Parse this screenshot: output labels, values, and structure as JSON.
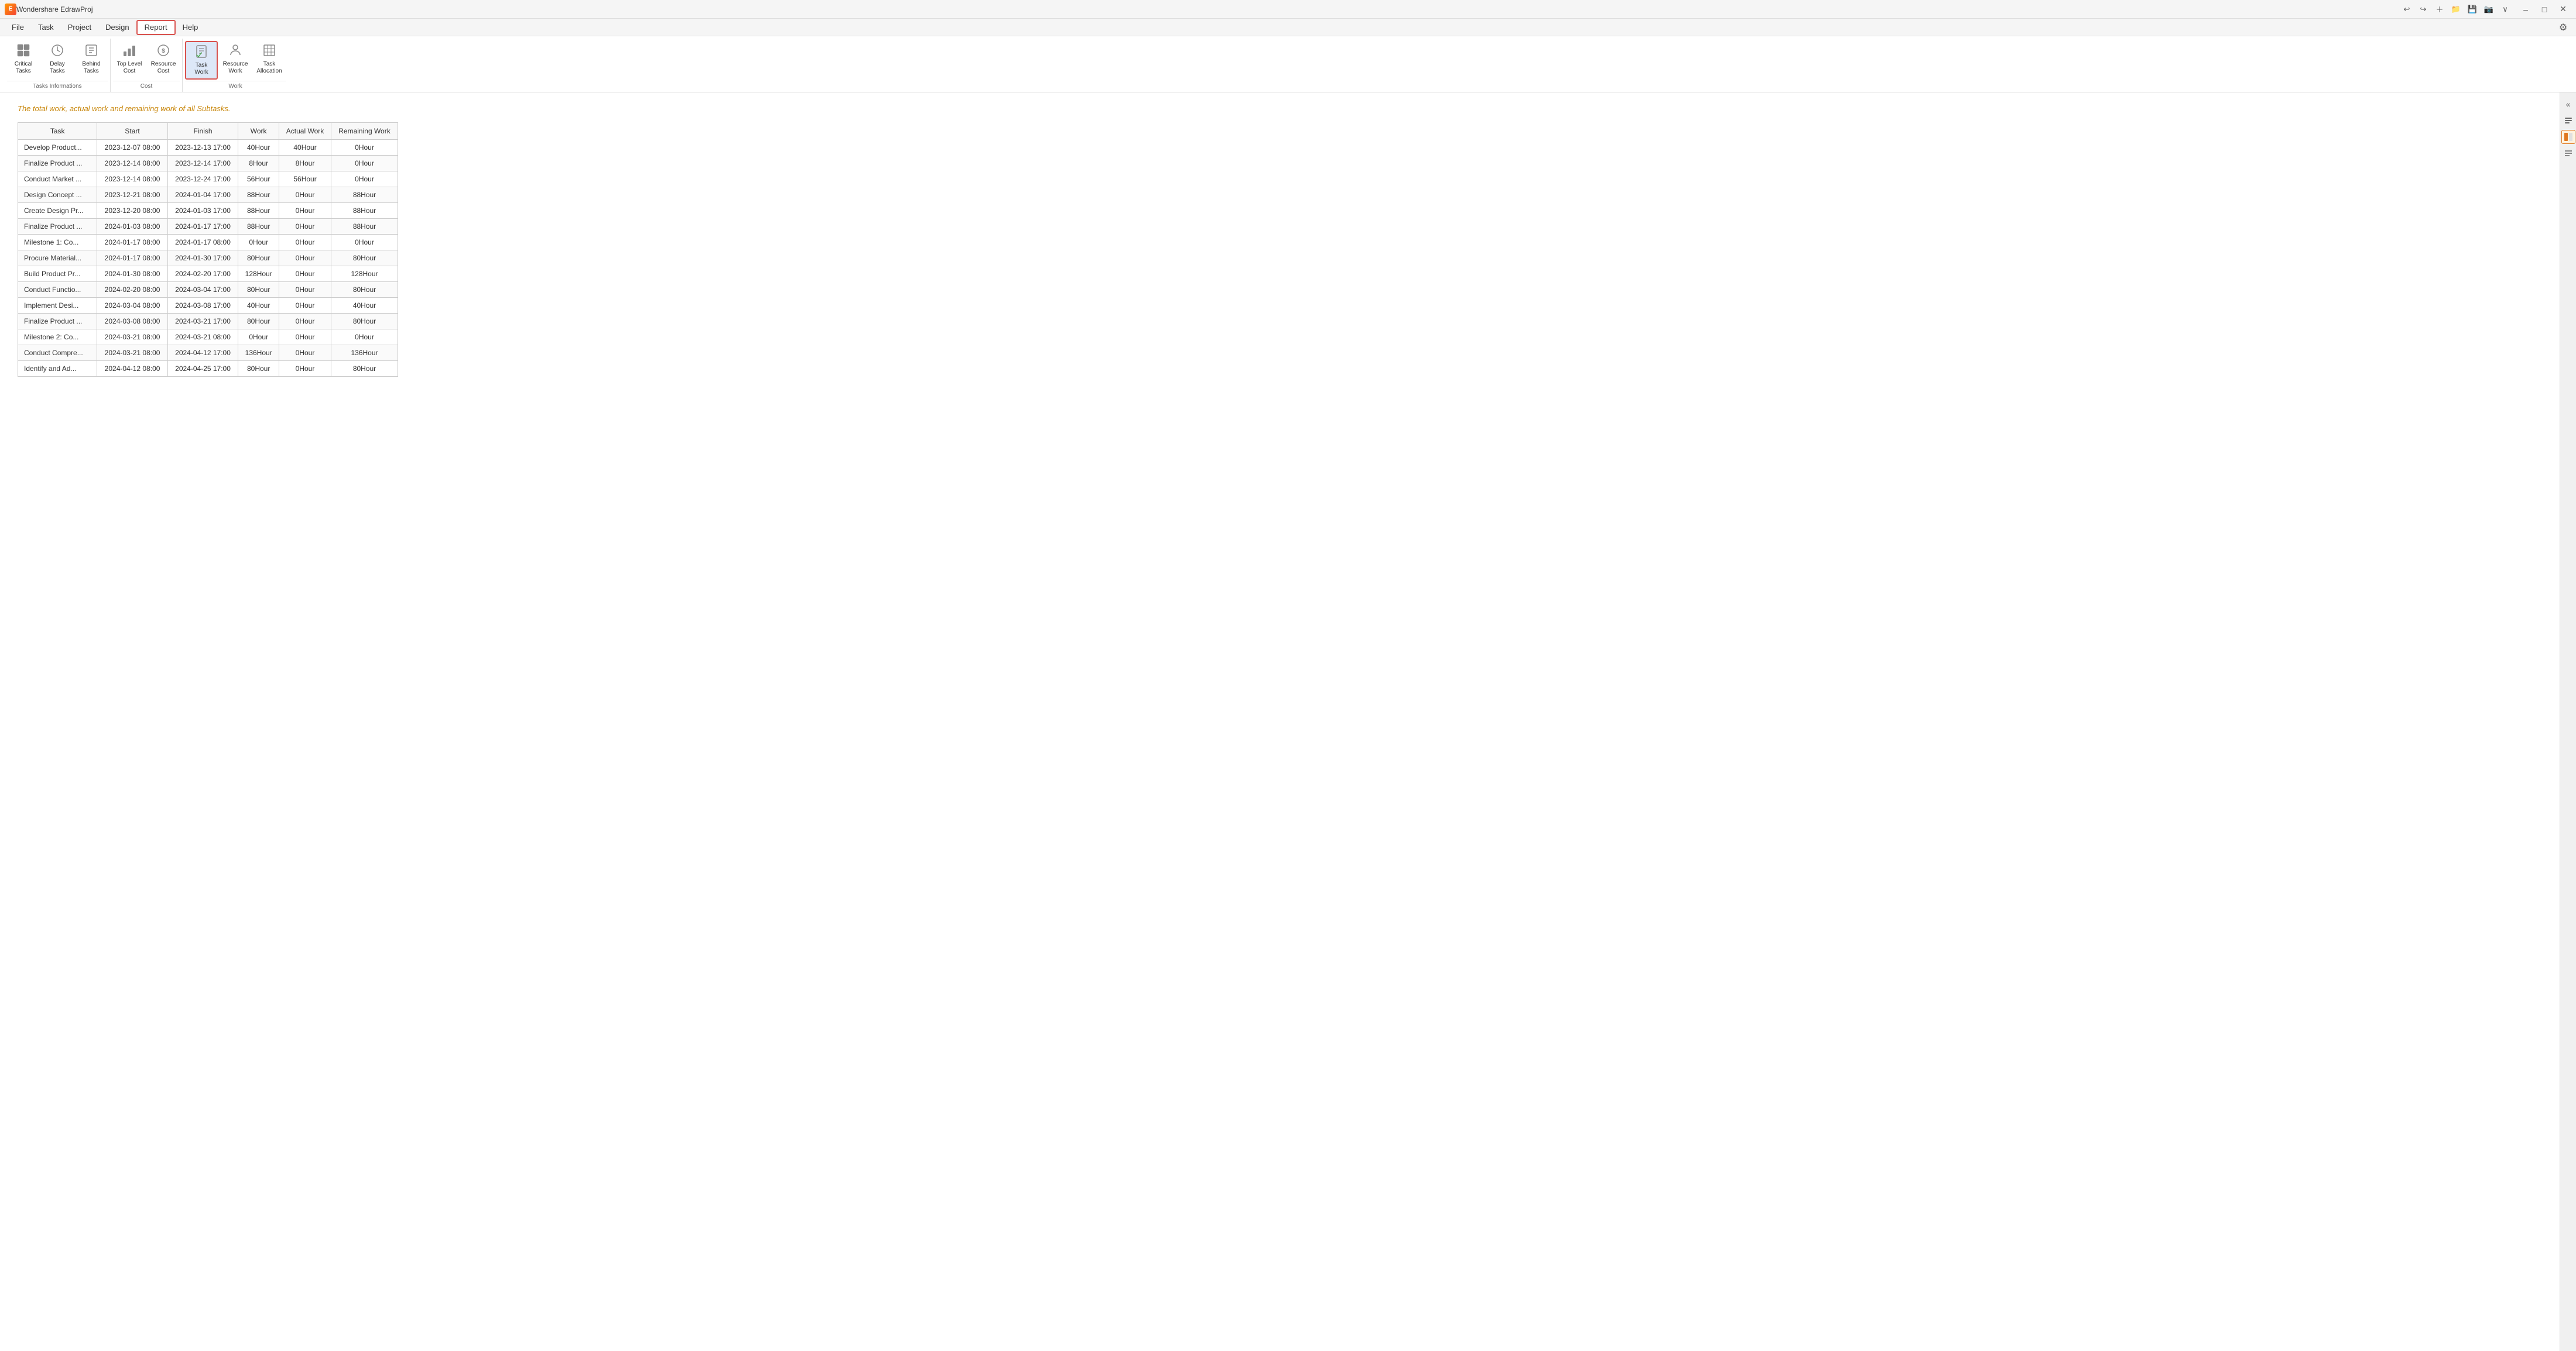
{
  "app": {
    "title": "Wondershare EdrawProj",
    "logo_text": "E"
  },
  "title_bar": {
    "undo_label": "↩",
    "redo_label": "↪",
    "new_label": "＋",
    "open_label": "📁",
    "save_label": "💾",
    "capture_label": "📷",
    "more_label": "∨",
    "minimize_label": "–",
    "maximize_label": "□",
    "close_label": "✕"
  },
  "menu": {
    "items": [
      {
        "id": "file",
        "label": "File"
      },
      {
        "id": "task",
        "label": "Task"
      },
      {
        "id": "project",
        "label": "Project"
      },
      {
        "id": "design",
        "label": "Design"
      },
      {
        "id": "report",
        "label": "Report",
        "active": true
      },
      {
        "id": "help",
        "label": "Help"
      }
    ],
    "gear_label": "⚙"
  },
  "ribbon": {
    "groups": [
      {
        "id": "tasks-informations",
        "label": "Tasks Informations",
        "buttons": [
          {
            "id": "critical-tasks",
            "icon": "⊞",
            "label": "Critical\nTasks"
          },
          {
            "id": "delay-tasks",
            "icon": "⏱",
            "label": "Delay\nTasks"
          },
          {
            "id": "behind-tasks",
            "icon": "⚑",
            "label": "Behind\nTasks"
          }
        ]
      },
      {
        "id": "cost",
        "label": "Cost",
        "buttons": [
          {
            "id": "top-level-cost",
            "icon": "💹",
            "label": "Top Level\nCost"
          },
          {
            "id": "resource-cost",
            "icon": "💰",
            "label": "Resource\nCost"
          }
        ]
      },
      {
        "id": "work",
        "label": "Work",
        "buttons": [
          {
            "id": "task-work",
            "icon": "📋",
            "label": "Task\nWork",
            "active": true
          },
          {
            "id": "resource-work",
            "icon": "👷",
            "label": "Resource\nWork"
          },
          {
            "id": "task-allocation",
            "icon": "📊",
            "label": "Task\nAllocation"
          }
        ]
      }
    ]
  },
  "content": {
    "subtitle": "The total work, actual work and remaining work of all Subtasks.",
    "table": {
      "headers": [
        "Task",
        "Start",
        "Finish",
        "Work",
        "Actual Work",
        "Remaining Work"
      ],
      "rows": [
        {
          "task": "Develop Product...",
          "start": "2023-12-07 08:00",
          "finish": "2023-12-13 17:00",
          "work": "40Hour",
          "actual_work": "40Hour",
          "remaining_work": "0Hour"
        },
        {
          "task": "Finalize Product ...",
          "start": "2023-12-14 08:00",
          "finish": "2023-12-14 17:00",
          "work": "8Hour",
          "actual_work": "8Hour",
          "remaining_work": "0Hour"
        },
        {
          "task": "Conduct Market ...",
          "start": "2023-12-14 08:00",
          "finish": "2023-12-24 17:00",
          "work": "56Hour",
          "actual_work": "56Hour",
          "remaining_work": "0Hour"
        },
        {
          "task": "Design Concept ...",
          "start": "2023-12-21 08:00",
          "finish": "2024-01-04 17:00",
          "work": "88Hour",
          "actual_work": "0Hour",
          "remaining_work": "88Hour"
        },
        {
          "task": "Create Design Pr...",
          "start": "2023-12-20 08:00",
          "finish": "2024-01-03 17:00",
          "work": "88Hour",
          "actual_work": "0Hour",
          "remaining_work": "88Hour"
        },
        {
          "task": "Finalize Product ...",
          "start": "2024-01-03 08:00",
          "finish": "2024-01-17 17:00",
          "work": "88Hour",
          "actual_work": "0Hour",
          "remaining_work": "88Hour"
        },
        {
          "task": "Milestone 1: Co...",
          "start": "2024-01-17 08:00",
          "finish": "2024-01-17 08:00",
          "work": "0Hour",
          "actual_work": "0Hour",
          "remaining_work": "0Hour"
        },
        {
          "task": "Procure Material...",
          "start": "2024-01-17 08:00",
          "finish": "2024-01-30 17:00",
          "work": "80Hour",
          "actual_work": "0Hour",
          "remaining_work": "80Hour"
        },
        {
          "task": "Build Product Pr...",
          "start": "2024-01-30 08:00",
          "finish": "2024-02-20 17:00",
          "work": "128Hour",
          "actual_work": "0Hour",
          "remaining_work": "128Hour"
        },
        {
          "task": "Conduct Functio...",
          "start": "2024-02-20 08:00",
          "finish": "2024-03-04 17:00",
          "work": "80Hour",
          "actual_work": "0Hour",
          "remaining_work": "80Hour"
        },
        {
          "task": "Implement Desi...",
          "start": "2024-03-04 08:00",
          "finish": "2024-03-08 17:00",
          "work": "40Hour",
          "actual_work": "0Hour",
          "remaining_work": "40Hour"
        },
        {
          "task": "Finalize Product ...",
          "start": "2024-03-08 08:00",
          "finish": "2024-03-21 17:00",
          "work": "80Hour",
          "actual_work": "0Hour",
          "remaining_work": "80Hour"
        },
        {
          "task": "Milestone 2: Co...",
          "start": "2024-03-21 08:00",
          "finish": "2024-03-21 08:00",
          "work": "0Hour",
          "actual_work": "0Hour",
          "remaining_work": "0Hour"
        },
        {
          "task": "Conduct Compre...",
          "start": "2024-03-21 08:00",
          "finish": "2024-04-12 17:00",
          "work": "136Hour",
          "actual_work": "0Hour",
          "remaining_work": "136Hour"
        },
        {
          "task": "Identify and Ad...",
          "start": "2024-04-12 08:00",
          "finish": "2024-04-25 17:00",
          "work": "80Hour",
          "actual_work": "0Hour",
          "remaining_work": "80Hour"
        }
      ]
    }
  },
  "right_sidebar": {
    "icons": [
      {
        "id": "sidebar-toggle",
        "label": "«"
      },
      {
        "id": "properties",
        "label": "≡"
      },
      {
        "id": "highlight",
        "label": "◧",
        "highlighted": true
      },
      {
        "id": "format",
        "label": "≣"
      }
    ]
  }
}
